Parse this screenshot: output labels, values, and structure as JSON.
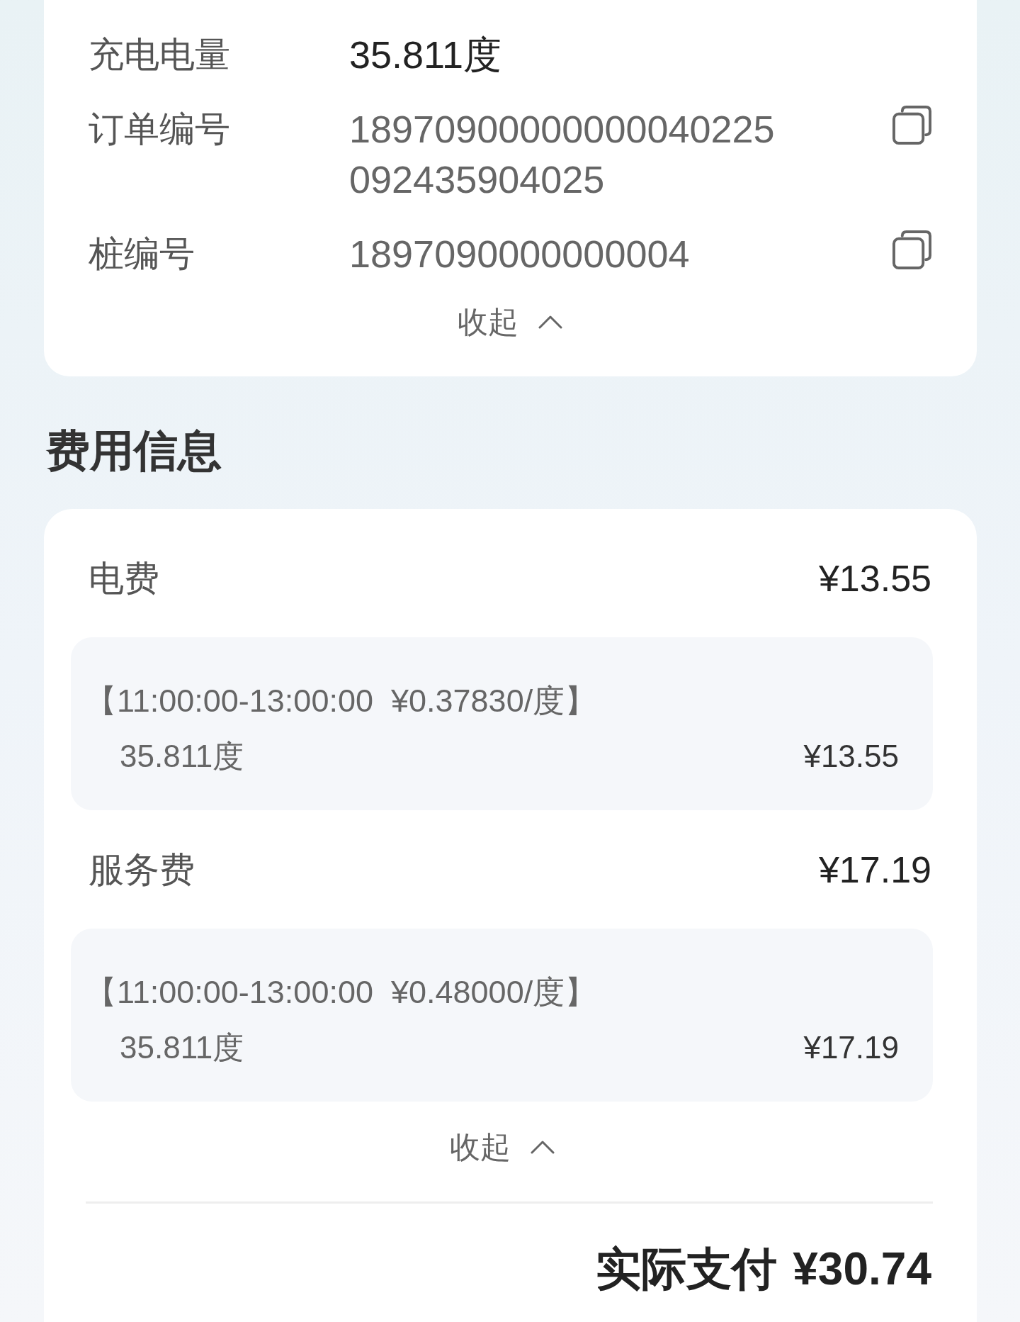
{
  "details_card": {
    "rows": [
      {
        "label": "充电电量",
        "kind": "highlight",
        "value_lines": [
          "35.811度"
        ]
      },
      {
        "label": "订单编号",
        "kind": "copyable",
        "value_lines": [
          "18970900000000040225",
          "092435904025"
        ]
      },
      {
        "label": "桩编号",
        "kind": "copyable",
        "value_lines": [
          "1897090000000004"
        ]
      }
    ],
    "collapse_button": {
      "label": "收起"
    }
  },
  "fee_section": {
    "title": "费用信息",
    "items": [
      {
        "label": "电费",
        "amount": "¥13.55",
        "details": [
          {
            "period": "【11:00:00-13:00:00  ¥0.37830/度】",
            "quantity": "35.811度",
            "amount": "¥13.55"
          }
        ]
      },
      {
        "label": "服务费",
        "amount": "¥17.19",
        "details": [
          {
            "period": "【11:00:00-13:00:00  ¥0.48000/度】",
            "quantity": "35.811度",
            "amount": "¥17.19"
          }
        ]
      }
    ],
    "collapse_button": {
      "label": "收起"
    },
    "total": {
      "label": "实际支付",
      "amount": "¥30.74"
    }
  }
}
